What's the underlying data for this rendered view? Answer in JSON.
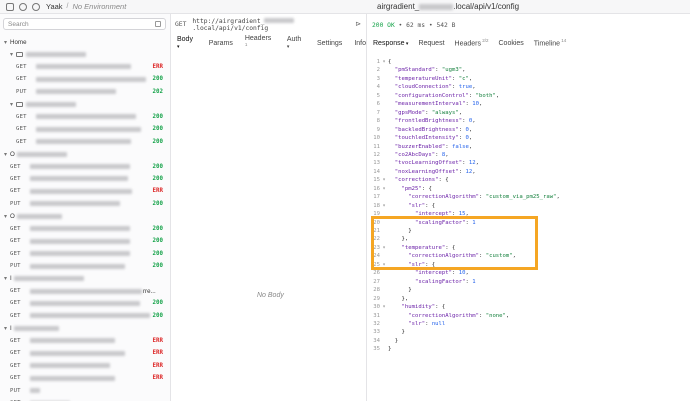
{
  "titlebar": {
    "app": "Yaak",
    "environment": "No Environment",
    "title_prefix": "airgradient_",
    "title_suffix": ".local/api/v1/config"
  },
  "sidebar": {
    "search_placeholder": "Search",
    "home_label": "Home",
    "rows": [
      {
        "type": "folder",
        "level": 0,
        "label": "Home",
        "caret": "▾"
      },
      {
        "type": "folder",
        "level": 1,
        "caret": "▾",
        "blur_w": 60
      },
      {
        "type": "request",
        "level": 2,
        "method": "GET",
        "status": "ERR",
        "status_class": "err",
        "blur_w": 95
      },
      {
        "type": "request",
        "level": 2,
        "method": "GET",
        "status": "200",
        "status_class": "ok",
        "blur_w": 110
      },
      {
        "type": "request",
        "level": 2,
        "method": "PUT",
        "status": "202",
        "status_class": "ok",
        "blur_w": 80
      },
      {
        "type": "folder",
        "level": 1,
        "caret": "▾",
        "blur_w": 50
      },
      {
        "type": "request",
        "level": 2,
        "method": "GET",
        "status": "200",
        "status_class": "ok",
        "blur_w": 100
      },
      {
        "type": "request",
        "level": 2,
        "method": "GET",
        "status": "200",
        "status_class": "ok",
        "blur_w": 105
      },
      {
        "type": "request",
        "level": 2,
        "method": "GET",
        "status": "200",
        "status_class": "ok",
        "blur_w": 95
      },
      {
        "type": "folder",
        "level": 0,
        "caret": "▾",
        "label": "O",
        "blur_w": 50
      },
      {
        "type": "request",
        "level": 1,
        "method": "GET",
        "status": "200",
        "status_class": "ok",
        "blur_w": 100
      },
      {
        "type": "request",
        "level": 1,
        "method": "GET",
        "status": "200",
        "status_class": "ok",
        "blur_w": 98
      },
      {
        "type": "request",
        "level": 1,
        "method": "GET",
        "status": "ERR",
        "status_class": "err",
        "blur_w": 102
      },
      {
        "type": "request",
        "level": 1,
        "method": "PUT",
        "status": "200",
        "status_class": "ok",
        "blur_w": 90
      },
      {
        "type": "folder",
        "level": 0,
        "caret": "▾",
        "label": "O",
        "blur_w": 45
      },
      {
        "type": "request",
        "level": 1,
        "method": "GET",
        "status": "200",
        "status_class": "ok",
        "blur_w": 100
      },
      {
        "type": "request",
        "level": 1,
        "method": "GET",
        "status": "200",
        "status_class": "ok",
        "blur_w": 100
      },
      {
        "type": "request",
        "level": 1,
        "method": "GET",
        "status": "200",
        "status_class": "ok",
        "blur_w": 100
      },
      {
        "type": "request",
        "level": 1,
        "method": "PUT",
        "status": "200",
        "status_class": "ok",
        "blur_w": 95
      },
      {
        "type": "folder",
        "level": 0,
        "caret": "▾",
        "label": "I",
        "blur_w": 70
      },
      {
        "type": "request",
        "level": 1,
        "method": "GET",
        "status": "",
        "status_class": "ok",
        "blur_w": 112,
        "suffix": "rre..."
      },
      {
        "type": "request",
        "level": 1,
        "method": "GET",
        "status": "200",
        "status_class": "ok",
        "blur_w": 110
      },
      {
        "type": "request",
        "level": 1,
        "method": "GET",
        "status": "200",
        "status_class": "ok",
        "blur_w": 120
      },
      {
        "type": "folder",
        "level": 0,
        "caret": "▾",
        "label": "I",
        "blur_w": 45
      },
      {
        "type": "request",
        "level": 1,
        "method": "GET",
        "status": "ERR",
        "status_class": "err",
        "blur_w": 85
      },
      {
        "type": "request",
        "level": 1,
        "method": "GET",
        "status": "ERR",
        "status_class": "err",
        "blur_w": 95
      },
      {
        "type": "request",
        "level": 1,
        "method": "GET",
        "status": "ERR",
        "status_class": "err",
        "blur_w": 80
      },
      {
        "type": "request",
        "level": 1,
        "method": "GET",
        "status": "ERR",
        "status_class": "err",
        "blur_w": 85
      },
      {
        "type": "request",
        "level": 1,
        "method": "PUT",
        "status": "",
        "status_class": "ok",
        "blur_w": 10
      },
      {
        "type": "request",
        "level": 1,
        "method": "GET",
        "status": "",
        "status_class": "ok",
        "blur_w": 40
      }
    ]
  },
  "request": {
    "method": "GET",
    "url_prefix": "http://airgradient_",
    "url_suffix": ".local/api/v1/config",
    "tabs": [
      {
        "label": "Body",
        "caret": "▾",
        "active": true
      },
      {
        "label": "Params"
      },
      {
        "label": "Headers",
        "badge": "1"
      },
      {
        "label": "Auth",
        "caret": "▾"
      },
      {
        "label": "Settings"
      },
      {
        "label": "Info"
      }
    ],
    "empty_body": "No Body"
  },
  "response": {
    "status_code": "200 OK",
    "time": "62 ms",
    "size": "542 B",
    "tabs": [
      {
        "label": "Response",
        "caret": "▾",
        "active": true
      },
      {
        "label": "Request"
      },
      {
        "label": "Headers",
        "badge": "2/2"
      },
      {
        "label": "Cookies"
      },
      {
        "label": "Timeline",
        "badge": "14"
      }
    ],
    "lines": [
      {
        "n": "1",
        "fold": "▾",
        "t": "{"
      },
      {
        "n": "2",
        "t": "  \"pmStandard\": \"ugm3\","
      },
      {
        "n": "3",
        "t": "  \"temperatureUnit\": \"c\","
      },
      {
        "n": "4",
        "t": "  \"cloudConnection\": true,"
      },
      {
        "n": "5",
        "t": "  \"configurationControl\": \"both\","
      },
      {
        "n": "6",
        "t": "  \"measurementInterval\": 10,"
      },
      {
        "n": "7",
        "t": "  \"gpsMode\": \"always\","
      },
      {
        "n": "8",
        "t": "  \"frontledBrightness\": 0,"
      },
      {
        "n": "9",
        "t": "  \"backledBrightness\": 0,"
      },
      {
        "n": "10",
        "t": "  \"touchledIntensity\": 0,"
      },
      {
        "n": "11",
        "t": "  \"buzzerEnabled\": false,"
      },
      {
        "n": "12",
        "t": "  \"co2AbcDays\": 8,"
      },
      {
        "n": "13",
        "t": "  \"tvocLearningOffset\": 12,"
      },
      {
        "n": "14",
        "t": "  \"noxLearningOffset\": 12,"
      },
      {
        "n": "15",
        "fold": "▾",
        "t": "  \"corrections\": {"
      },
      {
        "n": "16",
        "fold": "▾",
        "t": "    \"pm25\": {"
      },
      {
        "n": "17",
        "t": "      \"correctionAlgorithm\": \"custom_via_pm25_raw\","
      },
      {
        "n": "18",
        "fold": "▾",
        "t": "      \"slr\": {"
      },
      {
        "n": "19",
        "t": "        \"intercept\": 15,"
      },
      {
        "n": "20",
        "t": "        \"scalingFactor\": 1"
      },
      {
        "n": "21",
        "t": "      }"
      },
      {
        "n": "22",
        "t": "    },"
      },
      {
        "n": "23",
        "fold": "▾",
        "t": "    \"temperature\": {"
      },
      {
        "n": "24",
        "t": "      \"correctionAlgorithm\": \"custom\","
      },
      {
        "n": "25",
        "fold": "▾",
        "t": "      \"slr\": {"
      },
      {
        "n": "26",
        "t": "        \"intercept\": 10,"
      },
      {
        "n": "27",
        "t": "        \"scalingFactor\": 1"
      },
      {
        "n": "28",
        "t": "      }"
      },
      {
        "n": "29",
        "t": "    },"
      },
      {
        "n": "30",
        "fold": "▾",
        "t": "    \"humidity\": {"
      },
      {
        "n": "31",
        "t": "      \"correctionAlgorithm\": \"none\","
      },
      {
        "n": "32",
        "t": "      \"slr\": null"
      },
      {
        "n": "33",
        "t": "    }"
      },
      {
        "n": "34",
        "t": "  }"
      },
      {
        "n": "35",
        "t": "}"
      }
    ]
  },
  "colors": {
    "highlight": "#f5a623",
    "ok": "#16a34a",
    "err": "#dc2626"
  }
}
